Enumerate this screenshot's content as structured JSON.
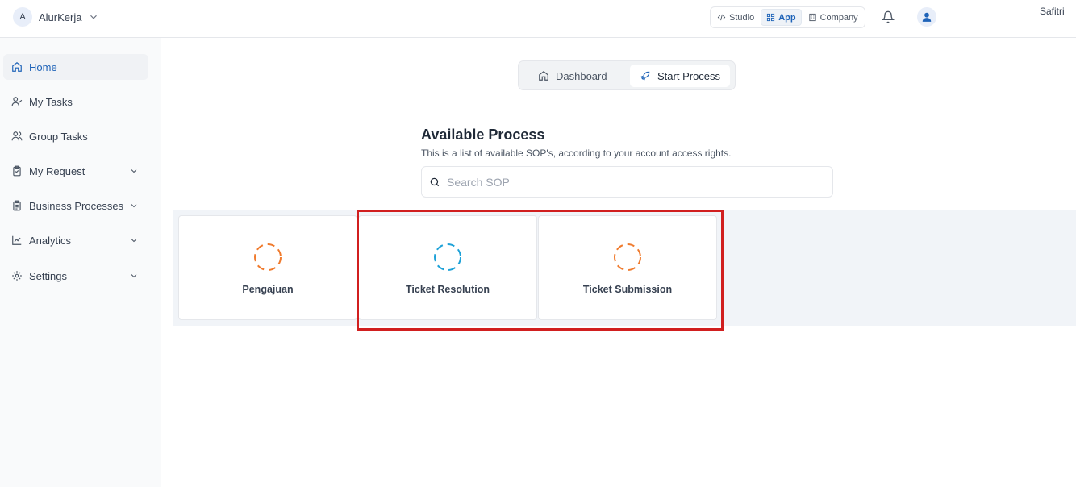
{
  "header": {
    "avatar_letter": "A",
    "brand": "AlurKerja",
    "modes": [
      {
        "label": "Studio",
        "icon": "code-icon"
      },
      {
        "label": "App",
        "icon": "grid-icon"
      },
      {
        "label": "Company",
        "icon": "building-icon"
      }
    ],
    "active_mode": "App",
    "username": "Safitri"
  },
  "sidebar": {
    "items": [
      {
        "label": "Home",
        "icon": "home-icon",
        "active": true
      },
      {
        "label": "My Tasks",
        "icon": "user-check-icon"
      },
      {
        "label": "Group Tasks",
        "icon": "users-icon"
      },
      {
        "label": "My Request",
        "icon": "clipboard-check-icon",
        "expandable": true
      },
      {
        "label": "Business Processes",
        "icon": "clipboard-list-icon",
        "expandable": true
      },
      {
        "label": "Analytics",
        "icon": "line-chart-icon",
        "expandable": true
      },
      {
        "label": "Settings",
        "icon": "gear-icon",
        "expandable": true
      }
    ]
  },
  "main": {
    "tabs": [
      {
        "label": "Dashboard",
        "icon": "home-icon"
      },
      {
        "label": "Start Process",
        "icon": "rocket-icon",
        "active": true
      }
    ],
    "title": "Available Process",
    "subtitle": "This is a list of available SOP's, according to your account access rights.",
    "search": {
      "placeholder": "Search SOP",
      "value": ""
    },
    "cards": [
      {
        "label": "Pengajuan",
        "icon_color": "#f07b2e"
      },
      {
        "label": "Ticket Resolution",
        "icon_color": "#1fa2d8"
      },
      {
        "label": "Ticket Submission",
        "icon_color": "#f07b2e"
      }
    ]
  },
  "colors": {
    "accent": "#1e63b8",
    "highlight": "#d11f1f"
  }
}
